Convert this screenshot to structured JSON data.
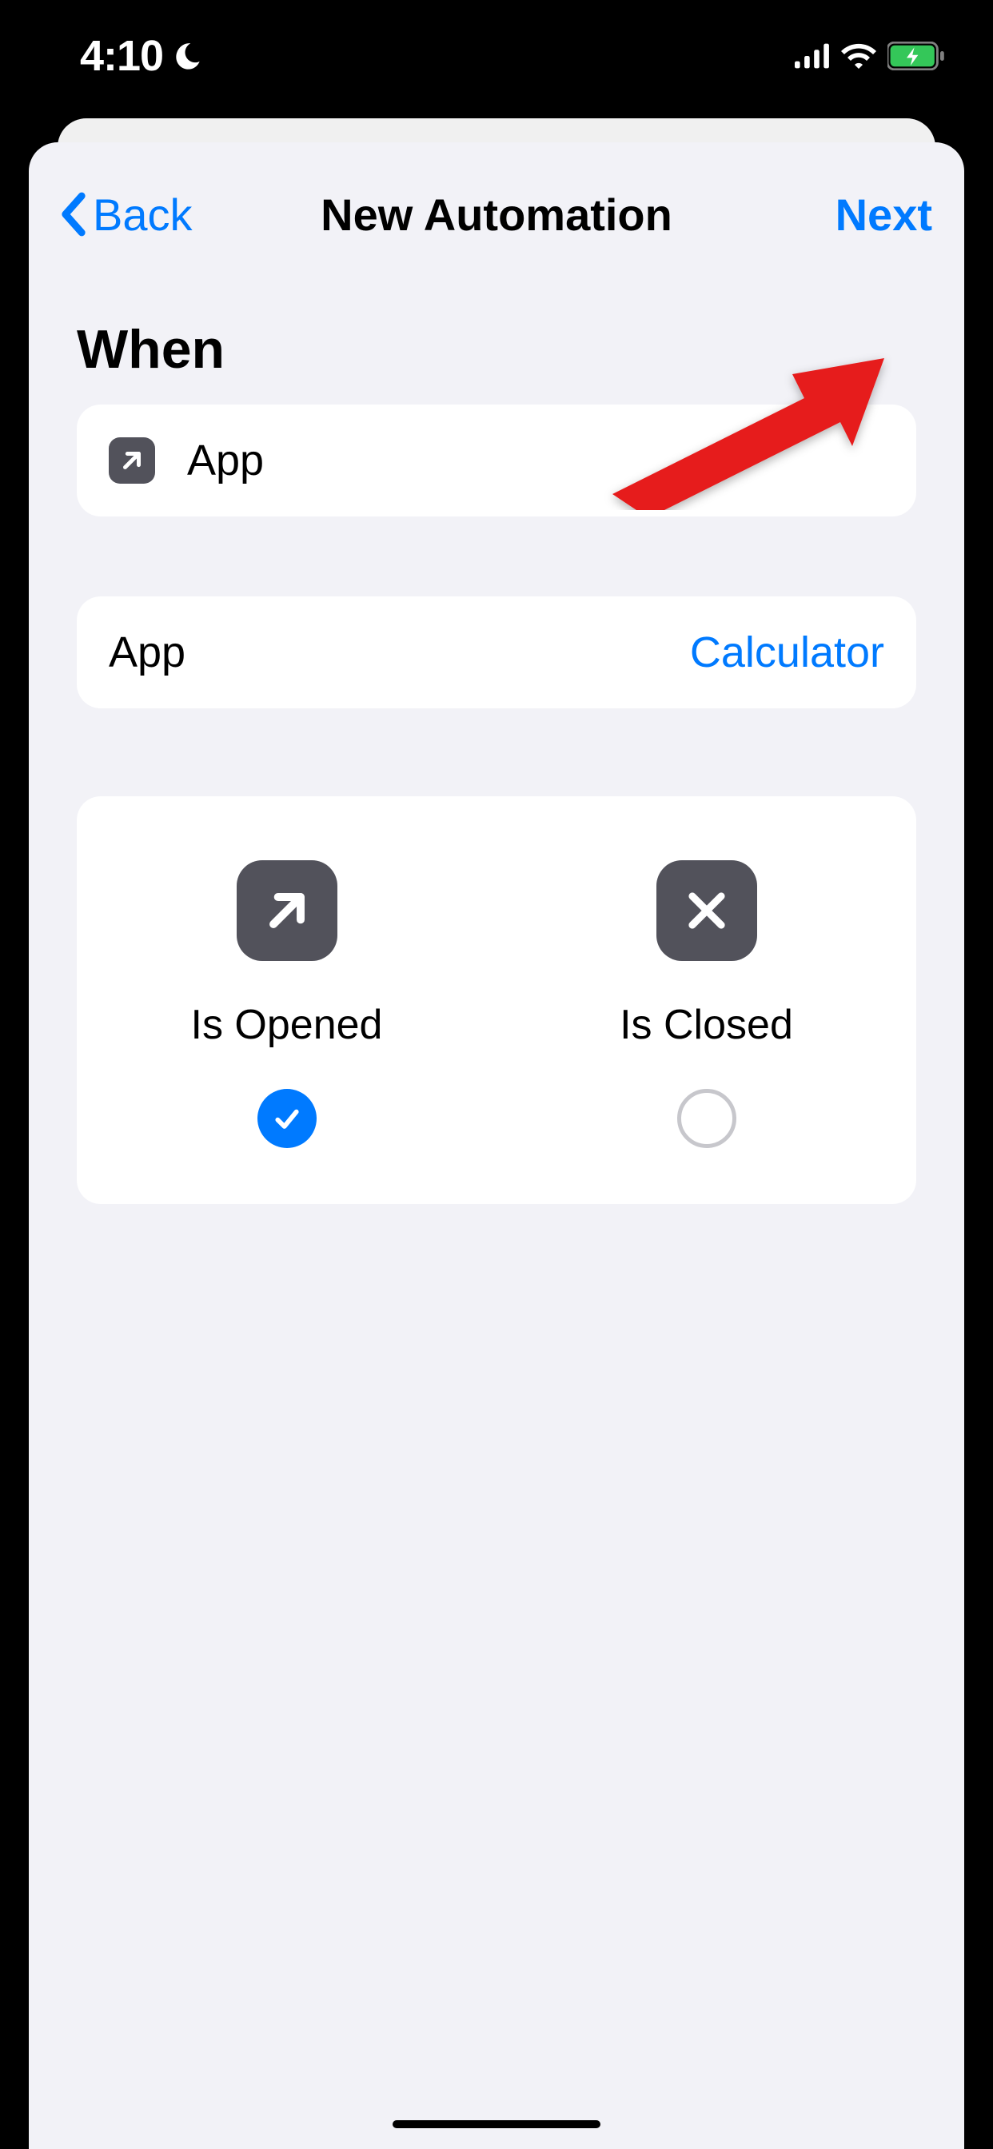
{
  "statusBar": {
    "time": "4:10"
  },
  "nav": {
    "back": "Back",
    "title": "New Automation",
    "next": "Next"
  },
  "sectionHeader": "When",
  "triggerCard": {
    "label": "App"
  },
  "appSelector": {
    "label": "App",
    "value": "Calculator"
  },
  "options": {
    "opened": {
      "label": "Is Opened",
      "checked": true
    },
    "closed": {
      "label": "Is Closed",
      "checked": false
    }
  }
}
